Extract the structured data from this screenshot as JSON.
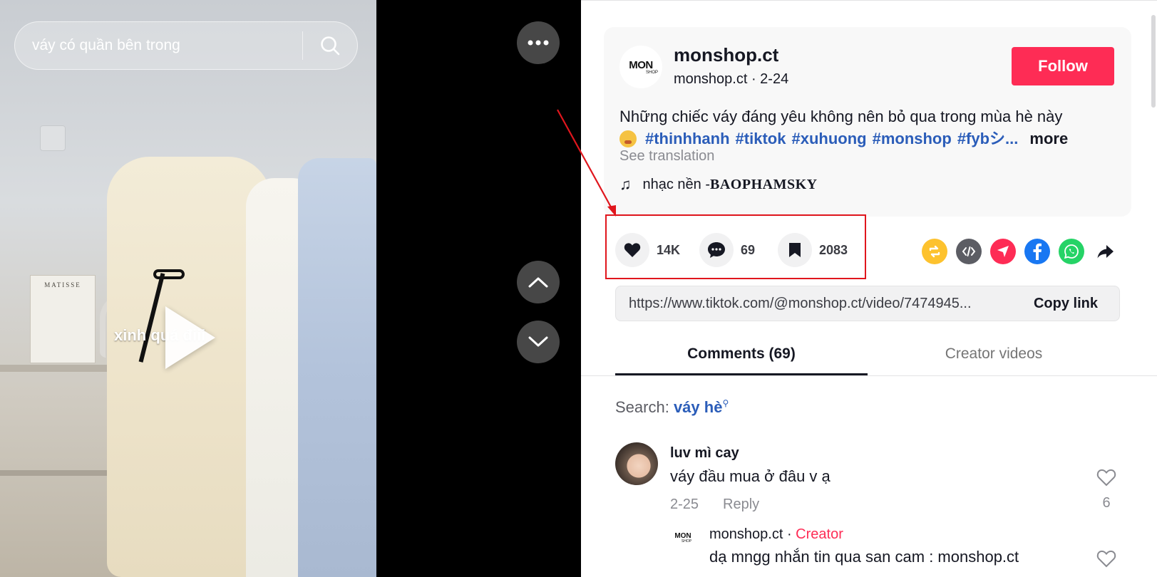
{
  "search": {
    "value": "váy có quần bên trong"
  },
  "video": {
    "overlay_text": "xinh quá điii",
    "book_title": "MATISSE"
  },
  "author": {
    "avatar_text_main": "MON",
    "avatar_text_sub": "SHOP",
    "name": "monshop.ct",
    "sub": "monshop.ct · 2-24",
    "follow_label": "Follow"
  },
  "description": {
    "line1": "Những chiếc váy đáng yêu không nên bỏ qua trong mùa hè này",
    "hashtags": [
      "#thinhhanh",
      "#tiktok",
      "#xuhuong",
      "#monshop",
      "#fybシ..."
    ],
    "more_label": "more",
    "see_translation": "See translation"
  },
  "music": {
    "prefix": "nhạc nền - ",
    "artist": "BAOPHAMSKY"
  },
  "stats": {
    "likes": "14K",
    "comments": "69",
    "saves": "2083"
  },
  "share_icons": [
    "repost-icon",
    "embed-icon",
    "send-icon",
    "facebook-icon",
    "whatsapp-icon",
    "share-arrow-icon"
  ],
  "colors": {
    "accent": "#fe2c55",
    "link": "#2b5db9",
    "highlight": "#e0161d"
  },
  "link": {
    "url": "https://www.tiktok.com/@monshop.ct/video/7474945...",
    "copy_label": "Copy link"
  },
  "tabs": [
    {
      "label": "Comments (69)",
      "active": true
    },
    {
      "label": "Creator videos",
      "active": false
    }
  ],
  "comment_search": {
    "prefix": "Search: ",
    "keyword": "váy hè"
  },
  "comments": [
    {
      "user": "luv mì cay",
      "text": "váy đầu mua ở đâu v ạ",
      "date": "2-25",
      "reply_label": "Reply",
      "likes": "6",
      "replies": [
        {
          "user": "monshop.ct",
          "badge": "Creator",
          "text": "dạ mngg nhắn tin qua san cam : monshop.ct"
        }
      ]
    }
  ]
}
